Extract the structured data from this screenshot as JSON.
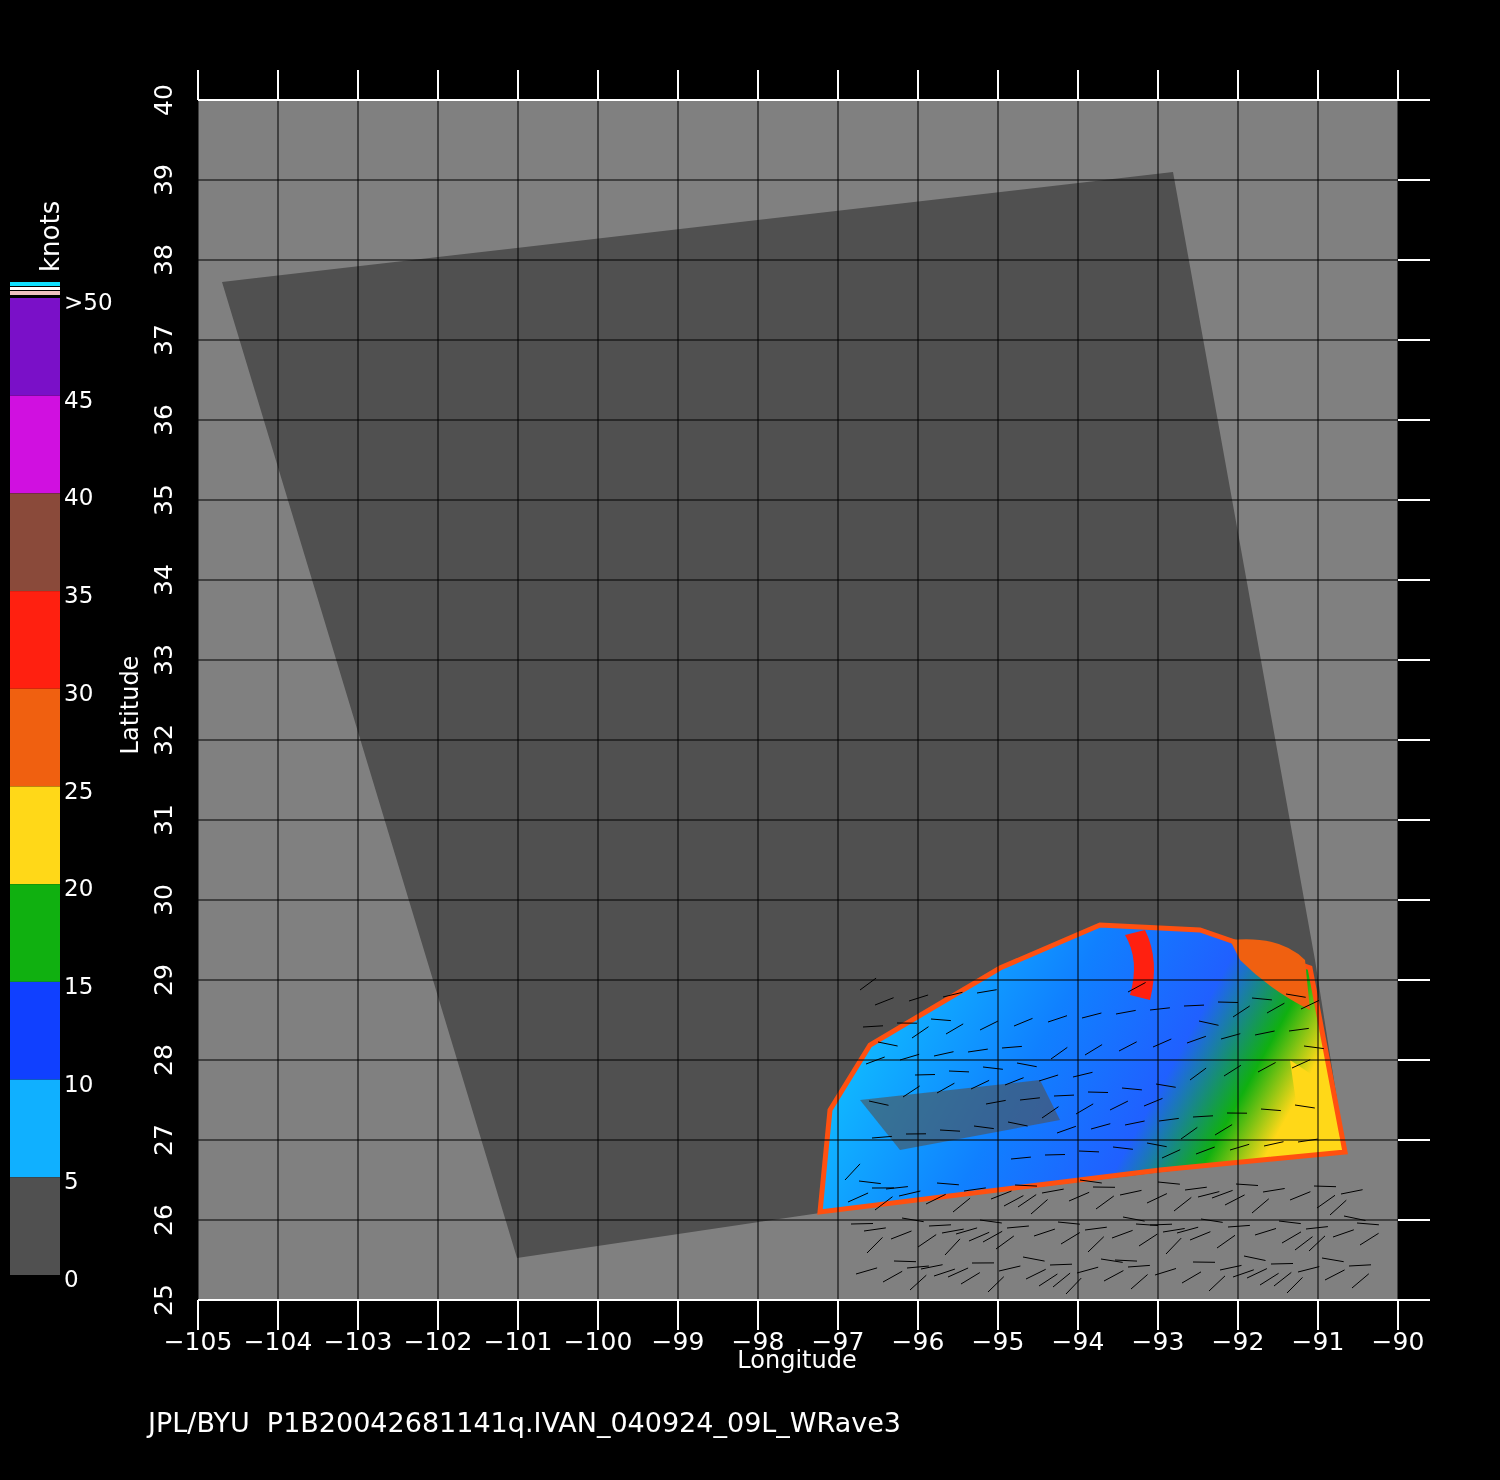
{
  "plot": {
    "xlabel": "Longitude",
    "ylabel": "Latitude",
    "xticks": [
      "−105",
      "−104",
      "−103",
      "−102",
      "−101",
      "−100",
      "−99",
      "−98",
      "−97",
      "−96",
      "−95",
      "−94",
      "−93",
      "−92",
      "−91",
      "−90"
    ],
    "yticks": [
      "40",
      "39",
      "38",
      "37",
      "36",
      "35",
      "34",
      "33",
      "32",
      "31",
      "30",
      "29",
      "28",
      "27",
      "26",
      "25"
    ]
  },
  "colorbar": {
    "unit": "knots",
    "bottom_label": "0",
    "segments": [
      {
        "label": ">50",
        "color": "#7a10c8"
      },
      {
        "label": "45",
        "color": "#d010e0"
      },
      {
        "label": "40",
        "color": "#8a4a3a"
      },
      {
        "label": "35",
        "color": "#ff2010"
      },
      {
        "label": "30",
        "color": "#f06010"
      },
      {
        "label": "25",
        "color": "#ffd818"
      },
      {
        "label": "20",
        "color": "#10b010"
      },
      {
        "label": "15",
        "color": "#1040ff"
      },
      {
        "label": "10",
        "color": "#10b0ff"
      },
      {
        "label": "5",
        "color": "#505050"
      }
    ]
  },
  "footer": "JPL/BYU  P1B20042681141q.IVAN_040924_09L_WRave3"
}
